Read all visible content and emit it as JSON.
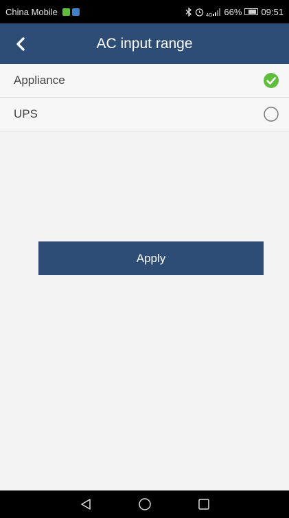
{
  "status_bar": {
    "carrier": "China Mobile",
    "battery_percent": "66%",
    "time": "09:51",
    "network": "4G",
    "icons": [
      "bluetooth-icon",
      "alarm-icon",
      "signal-icon",
      "battery-icon"
    ]
  },
  "header": {
    "title": "AC input range",
    "back_icon": "chevron-left-icon"
  },
  "options": [
    {
      "label": "Appliance",
      "selected": true
    },
    {
      "label": "UPS",
      "selected": false
    }
  ],
  "apply_button": {
    "label": "Apply"
  },
  "nav_bar": {
    "icons": [
      "back-triangle-icon",
      "home-circle-icon",
      "recents-square-icon"
    ]
  },
  "colors": {
    "accent": "#2e4d76",
    "selected": "#5fbf3d",
    "background": "#f3f3f3"
  }
}
